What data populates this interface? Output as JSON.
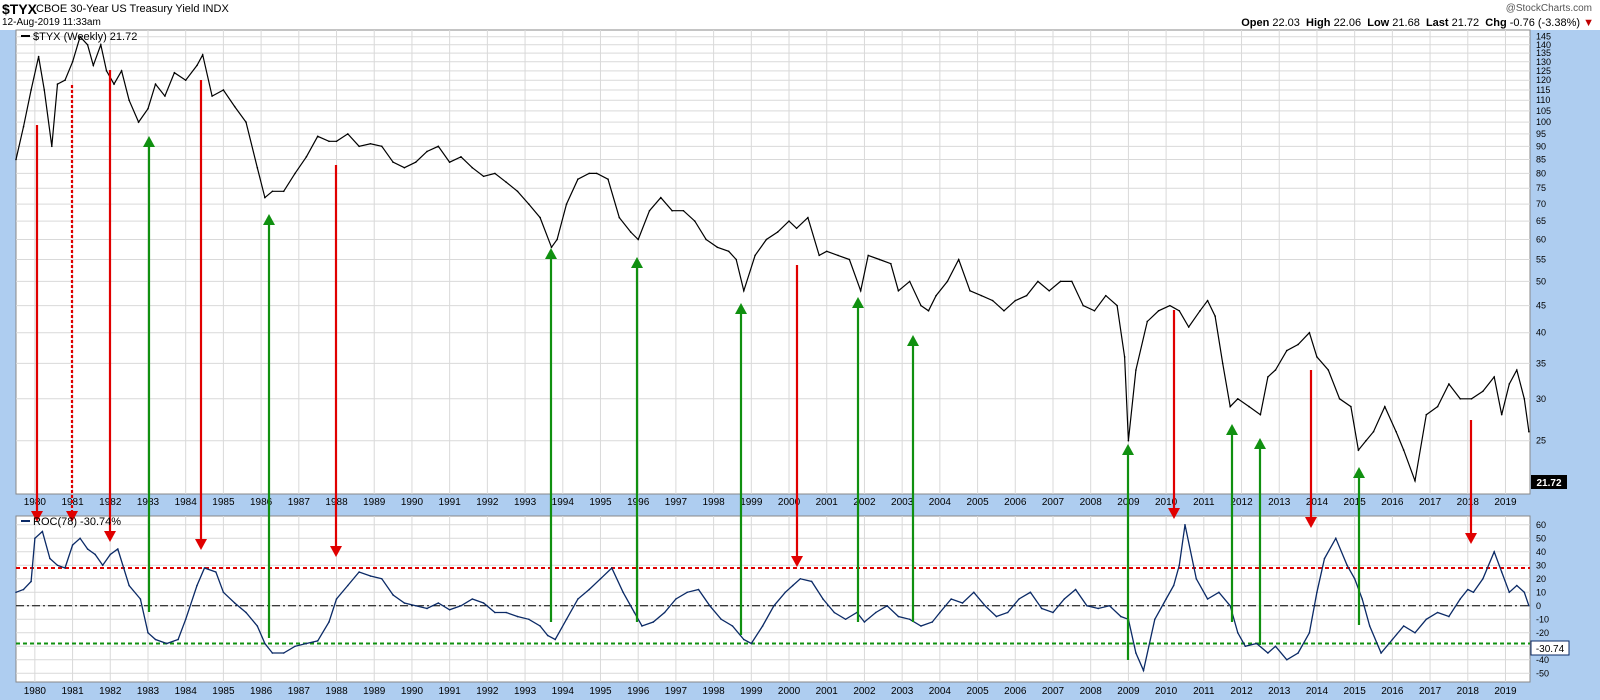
{
  "header": {
    "symbol": "$TYX",
    "name": "CBOE 30-Year US Treasury Yield INDX",
    "date": "12-Aug-2019 11:33am",
    "watermark": "@StockCharts.com",
    "open_label": "Open",
    "open": "22.03",
    "high_label": "High",
    "high": "22.06",
    "low_label": "Low",
    "low": "21.68",
    "last_label": "Last",
    "last": "21.72",
    "chg_label": "Chg",
    "chg": "-0.76 (-3.38%)",
    "chg_arrow": "▼"
  },
  "panels": {
    "price_legend": "$TYX (Weekly) 21.72",
    "price_last_label": "21.72",
    "roc_legend": "ROC(78) -30.74%",
    "roc_last_label": "-30.74"
  },
  "colors": {
    "price_line": "#000000",
    "roc_line": "#0b2a66",
    "sell_arrow": "#e00000",
    "buy_arrow": "#109010",
    "upper_band": "#e00000",
    "lower_band": "#109010",
    "grid": "#d9d9d9"
  },
  "chart_data": [
    {
      "type": "line",
      "name": "$TYX (Weekly)",
      "x_ticks": [
        "1980",
        "1981",
        "1982",
        "1983",
        "1984",
        "1985",
        "1986",
        "1987",
        "1988",
        "1989",
        "1990",
        "1991",
        "1992",
        "1993",
        "1994",
        "1995",
        "1996",
        "1997",
        "1998",
        "1999",
        "2000",
        "2001",
        "2002",
        "2003",
        "2004",
        "2005",
        "2006",
        "2007",
        "2008",
        "2009",
        "2010",
        "2011",
        "2012",
        "2013",
        "2014",
        "2015",
        "2016",
        "2017",
        "2018",
        "2019"
      ],
      "y_ticks": [
        25,
        30,
        35,
        40,
        45,
        50,
        55,
        60,
        65,
        70,
        75,
        80,
        85,
        90,
        95,
        100,
        105,
        110,
        115,
        120,
        125,
        130,
        135,
        140,
        145
      ],
      "y_scale": "log",
      "ylim": [
        20,
        148
      ],
      "xlim": [
        1979.5,
        2019.65
      ],
      "x": [
        1979.5,
        1979.7,
        1979.9,
        1980.1,
        1980.25,
        1980.45,
        1980.6,
        1980.8,
        1981.0,
        1981.2,
        1981.4,
        1981.55,
        1981.75,
        1981.9,
        1982.1,
        1982.3,
        1982.5,
        1982.75,
        1983.0,
        1983.2,
        1983.45,
        1983.7,
        1984.0,
        1984.3,
        1984.45,
        1984.7,
        1985.0,
        1985.3,
        1985.6,
        1985.9,
        1986.1,
        1986.3,
        1986.6,
        1986.9,
        1987.2,
        1987.5,
        1987.8,
        1988.0,
        1988.3,
        1988.6,
        1988.9,
        1989.2,
        1989.5,
        1989.8,
        1990.1,
        1990.4,
        1990.7,
        1991.0,
        1991.3,
        1991.6,
        1991.9,
        1992.2,
        1992.5,
        1992.8,
        1993.1,
        1993.4,
        1993.7,
        1993.85,
        1994.1,
        1994.4,
        1994.7,
        1994.9,
        1995.2,
        1995.5,
        1995.8,
        1996.0,
        1996.3,
        1996.6,
        1996.9,
        1997.2,
        1997.5,
        1997.8,
        1998.1,
        1998.4,
        1998.6,
        1998.8,
        1999.1,
        1999.4,
        1999.7,
        2000.0,
        2000.2,
        2000.5,
        2000.8,
        2001.0,
        2001.3,
        2001.6,
        2001.9,
        2002.1,
        2002.4,
        2002.7,
        2002.9,
        2003.2,
        2003.5,
        2003.7,
        2003.9,
        2004.2,
        2004.5,
        2004.8,
        2005.1,
        2005.4,
        2005.7,
        2006.0,
        2006.3,
        2006.6,
        2006.9,
        2007.2,
        2007.5,
        2007.8,
        2008.1,
        2008.4,
        2008.7,
        2008.9,
        2009.0,
        2009.2,
        2009.5,
        2009.8,
        2010.1,
        2010.35,
        2010.6,
        2010.9,
        2011.1,
        2011.3,
        2011.5,
        2011.7,
        2011.9,
        2012.2,
        2012.5,
        2012.7,
        2012.9,
        2013.2,
        2013.5,
        2013.8,
        2014.0,
        2014.3,
        2014.6,
        2014.9,
        2015.1,
        2015.3,
        2015.5,
        2015.8,
        2016.1,
        2016.3,
        2016.6,
        2016.9,
        2017.2,
        2017.5,
        2017.8,
        2018.1,
        2018.4,
        2018.7,
        2018.9,
        2019.1,
        2019.3,
        2019.5,
        2019.62
      ],
      "y": [
        85,
        98,
        115,
        133,
        115,
        90,
        118,
        120,
        130,
        145,
        140,
        128,
        140,
        125,
        118,
        125,
        110,
        100,
        106,
        118,
        112,
        124,
        120,
        128,
        134,
        112,
        115,
        107,
        100,
        82,
        72,
        74,
        74,
        80,
        86,
        94,
        92,
        92,
        95,
        90,
        91,
        90,
        84,
        82,
        84,
        88,
        90,
        84,
        86,
        82,
        79,
        80,
        77,
        74,
        70,
        66,
        58,
        60,
        70,
        78,
        80,
        80,
        78,
        66,
        62,
        60,
        68,
        72,
        68,
        68,
        65,
        60,
        58,
        57,
        55,
        48,
        56,
        60,
        62,
        65,
        63,
        66,
        56,
        57,
        56,
        55,
        48,
        56,
        55,
        54,
        48,
        50,
        45,
        44,
        47,
        50,
        55,
        48,
        47,
        46,
        44,
        46,
        47,
        50,
        48,
        50,
        50,
        45,
        44,
        47,
        45,
        36,
        25,
        34,
        42,
        44,
        45,
        44,
        41,
        44,
        46,
        43,
        35,
        29,
        30,
        29,
        28,
        33,
        34,
        37,
        38,
        40,
        36,
        34,
        30,
        29,
        24,
        25,
        26,
        29,
        26,
        24,
        21,
        28,
        29,
        32,
        30,
        30,
        31,
        33,
        28,
        32,
        34,
        30,
        26,
        22.03
      ],
      "last": 21.72
    },
    {
      "type": "line",
      "name": "ROC(78)",
      "x_ticks": [
        "1980",
        "1981",
        "1982",
        "1983",
        "1984",
        "1985",
        "1986",
        "1987",
        "1988",
        "1989",
        "1990",
        "1991",
        "1992",
        "1993",
        "1994",
        "1995",
        "1996",
        "1997",
        "1998",
        "1999",
        "2000",
        "2001",
        "2002",
        "2003",
        "2004",
        "2005",
        "2006",
        "2007",
        "2008",
        "2009",
        "2010",
        "2011",
        "2012",
        "2013",
        "2014",
        "2015",
        "2016",
        "2017",
        "2018",
        "2019"
      ],
      "y_ticks": [
        -50,
        -40,
        -30,
        -20,
        -10,
        0,
        10,
        20,
        30,
        40,
        50,
        60
      ],
      "ylim": [
        -55,
        65
      ],
      "xlim": [
        1979.5,
        2019.65
      ],
      "reference_lines": [
        28,
        0,
        -28
      ],
      "x": [
        1979.5,
        1979.7,
        1979.9,
        1980.0,
        1980.2,
        1980.4,
        1980.6,
        1980.8,
        1981.0,
        1981.2,
        1981.4,
        1981.6,
        1981.8,
        1982.0,
        1982.2,
        1982.5,
        1982.8,
        1983.0,
        1983.2,
        1983.5,
        1983.8,
        1984.0,
        1984.3,
        1984.5,
        1984.8,
        1985.0,
        1985.3,
        1985.6,
        1985.9,
        1986.1,
        1986.3,
        1986.6,
        1986.9,
        1987.2,
        1987.5,
        1987.8,
        1988.0,
        1988.3,
        1988.6,
        1988.9,
        1989.2,
        1989.5,
        1989.8,
        1990.1,
        1990.4,
        1990.7,
        1991.0,
        1991.3,
        1991.6,
        1991.9,
        1992.2,
        1992.5,
        1992.8,
        1993.1,
        1993.4,
        1993.6,
        1993.8,
        1994.1,
        1994.4,
        1994.7,
        1995.0,
        1995.3,
        1995.6,
        1995.9,
        1996.1,
        1996.4,
        1996.7,
        1997.0,
        1997.3,
        1997.6,
        1997.9,
        1998.2,
        1998.5,
        1998.8,
        1999.0,
        1999.3,
        1999.6,
        1999.9,
        2000.1,
        2000.3,
        2000.6,
        2000.9,
        2001.2,
        2001.5,
        2001.8,
        2002.0,
        2002.3,
        2002.6,
        2002.9,
        2003.2,
        2003.5,
        2003.8,
        2004.0,
        2004.3,
        2004.6,
        2004.9,
        2005.2,
        2005.5,
        2005.8,
        2006.1,
        2006.4,
        2006.7,
        2007.0,
        2007.3,
        2007.6,
        2007.9,
        2008.2,
        2008.5,
        2008.8,
        2009.0,
        2009.2,
        2009.4,
        2009.7,
        2010.0,
        2010.2,
        2010.35,
        2010.5,
        2010.8,
        2011.1,
        2011.4,
        2011.7,
        2011.9,
        2012.1,
        2012.4,
        2012.7,
        2012.9,
        2013.2,
        2013.5,
        2013.8,
        2014.0,
        2014.2,
        2014.5,
        2014.8,
        2015.0,
        2015.2,
        2015.4,
        2015.7,
        2016.0,
        2016.3,
        2016.6,
        2016.9,
        2017.2,
        2017.5,
        2017.8,
        2018.0,
        2018.15,
        2018.4,
        2018.7,
        2018.9,
        2019.1,
        2019.3,
        2019.5,
        2019.62
      ],
      "y": [
        10,
        12,
        18,
        50,
        55,
        35,
        30,
        28,
        45,
        50,
        42,
        38,
        30,
        38,
        42,
        15,
        5,
        -20,
        -25,
        -28,
        -25,
        -10,
        15,
        28,
        25,
        10,
        2,
        -5,
        -15,
        -28,
        -35,
        -35,
        -30,
        -28,
        -26,
        -12,
        5,
        15,
        25,
        22,
        20,
        8,
        2,
        0,
        -2,
        2,
        -3,
        0,
        5,
        2,
        -5,
        -5,
        -8,
        -10,
        -15,
        -22,
        -25,
        -10,
        5,
        12,
        20,
        28,
        10,
        -5,
        -15,
        -12,
        -5,
        5,
        10,
        12,
        0,
        -10,
        -15,
        -25,
        -28,
        -15,
        0,
        10,
        15,
        20,
        18,
        5,
        -5,
        -10,
        -5,
        -12,
        -5,
        0,
        -8,
        -10,
        -15,
        -12,
        -5,
        5,
        2,
        10,
        0,
        -8,
        -5,
        5,
        10,
        -2,
        -5,
        5,
        12,
        0,
        -2,
        0,
        -8,
        -10,
        -35,
        -48,
        -10,
        5,
        15,
        30,
        60,
        20,
        5,
        10,
        0,
        -20,
        -30,
        -28,
        -35,
        -30,
        -40,
        -35,
        -20,
        10,
        35,
        50,
        30,
        20,
        5,
        -15,
        -35,
        -25,
        -15,
        -20,
        -10,
        -5,
        -8,
        5,
        12,
        10,
        20,
        40,
        25,
        10,
        15,
        10,
        0,
        -8,
        -30.74
      ],
      "last": -30.74
    }
  ]
}
